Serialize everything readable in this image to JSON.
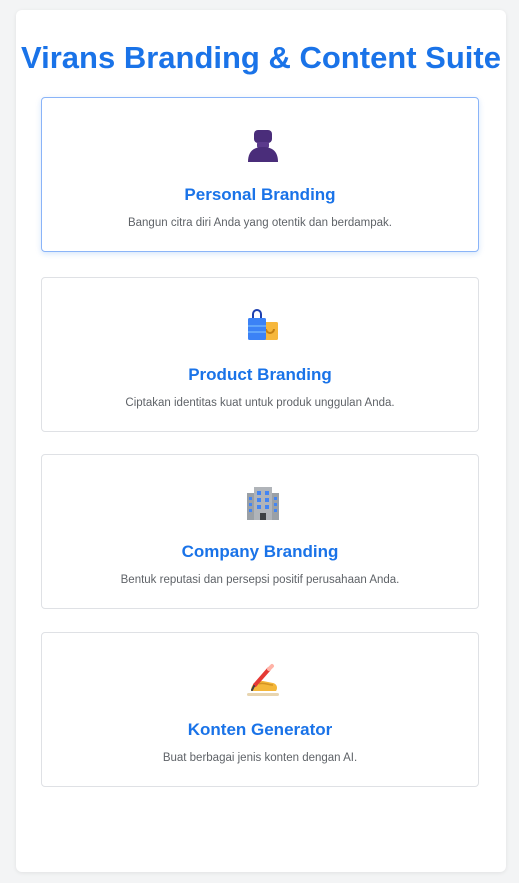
{
  "app": {
    "title": "Virans Branding & Content Suite"
  },
  "cards": [
    {
      "title": "Personal Branding",
      "desc": "Bangun citra diri Anda yang otentik dan berdampak.",
      "icon": "person-silhouette-icon"
    },
    {
      "title": "Product Branding",
      "desc": "Ciptakan identitas kuat untuk produk unggulan Anda.",
      "icon": "shopping-bags-icon"
    },
    {
      "title": "Company Branding",
      "desc": "Bentuk reputasi dan persepsi positif perusahaan Anda.",
      "icon": "office-building-icon"
    },
    {
      "title": "Konten Generator",
      "desc": "Buat berbagai jenis konten dengan AI.",
      "icon": "writing-hand-icon"
    }
  ],
  "colors": {
    "accent": "#1a73e8",
    "active_border": "#8ab4f8"
  }
}
